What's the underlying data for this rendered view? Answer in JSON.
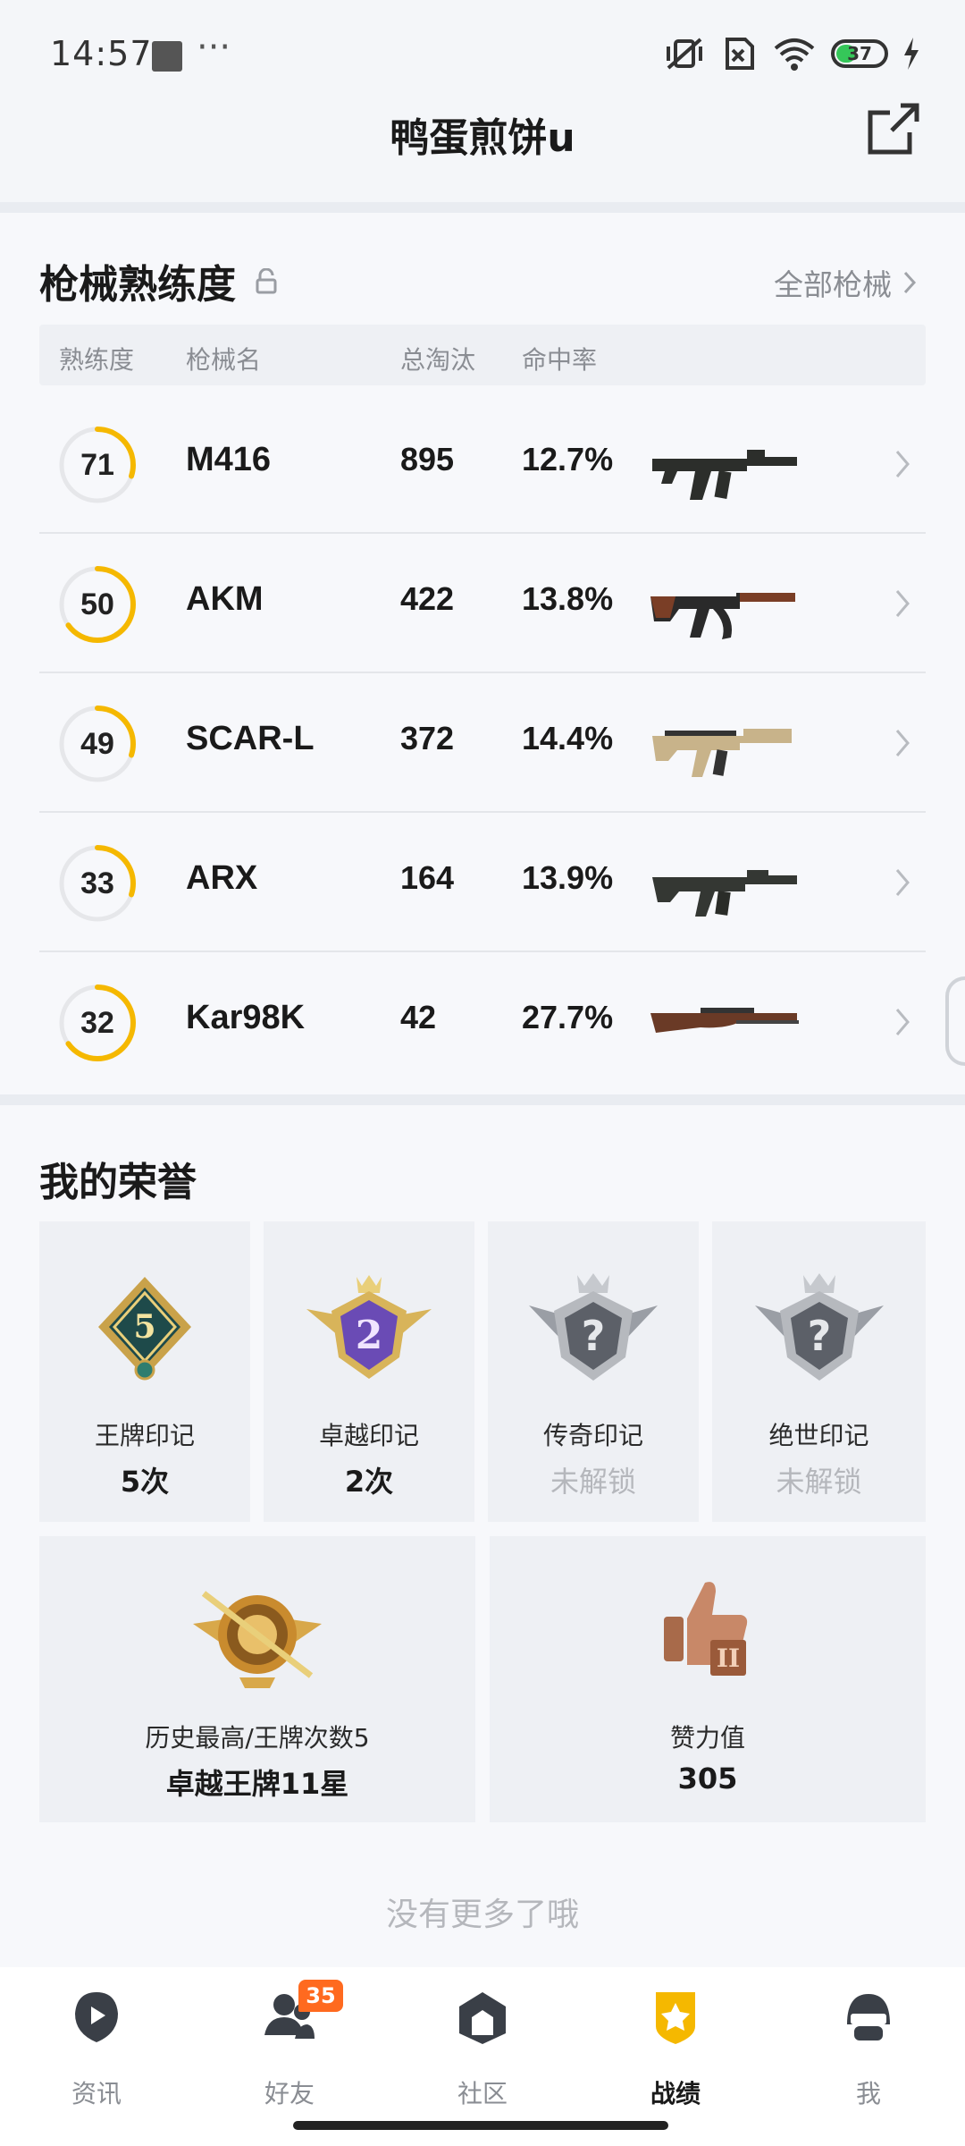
{
  "status_bar": {
    "time": "14:57",
    "dots": "···",
    "battery": "37"
  },
  "header": {
    "title": "鸭蛋煎饼u"
  },
  "weapons": {
    "title": "枪械熟练度",
    "all_link": "全部枪械",
    "columns": {
      "mastery": "熟练度",
      "name": "枪械名",
      "kills": "总淘汰",
      "accuracy": "命中率"
    },
    "rows": [
      {
        "mastery": "71",
        "mastery_fraction": 0.3,
        "name": "M416",
        "kills": "895",
        "accuracy": "12.7%",
        "gun_icon": "m416-rifle-icon"
      },
      {
        "mastery": "50",
        "mastery_fraction": 0.65,
        "name": "AKM",
        "kills": "422",
        "accuracy": "13.8%",
        "gun_icon": "akm-rifle-icon"
      },
      {
        "mastery": "49",
        "mastery_fraction": 0.3,
        "name": "SCAR-L",
        "kills": "372",
        "accuracy": "14.4%",
        "gun_icon": "scar-rifle-icon"
      },
      {
        "mastery": "33",
        "mastery_fraction": 0.3,
        "name": "ARX",
        "kills": "164",
        "accuracy": "13.9%",
        "gun_icon": "arx-rifle-icon"
      },
      {
        "mastery": "32",
        "mastery_fraction": 0.65,
        "name": "Kar98K",
        "kills": "42",
        "accuracy": "27.7%",
        "gun_icon": "kar98k-rifle-icon"
      }
    ]
  },
  "honors": {
    "title": "我的荣誉",
    "marks": [
      {
        "label": "王牌印记",
        "value": "5次",
        "locked": false,
        "badge_text": "5"
      },
      {
        "label": "卓越印记",
        "value": "2次",
        "locked": false,
        "badge_text": "2"
      },
      {
        "label": "传奇印记",
        "value": "未解锁",
        "locked": true,
        "badge_text": "?"
      },
      {
        "label": "绝世印记",
        "value": "未解锁",
        "locked": true,
        "badge_text": "?"
      }
    ],
    "history": {
      "label": "历史最高/王牌次数5",
      "value": "卓越王牌11星"
    },
    "likes": {
      "label": "赞力值",
      "value": "305"
    }
  },
  "footer_text": "没有更多了哦",
  "nav": {
    "items": [
      {
        "label": "资讯",
        "active": false
      },
      {
        "label": "好友",
        "active": false,
        "badge": "35"
      },
      {
        "label": "社区",
        "active": false
      },
      {
        "label": "战绩",
        "active": true
      },
      {
        "label": "我",
        "active": false
      }
    ]
  },
  "colors": {
    "accent": "#f5b800",
    "ring_track": "#e6e7ea",
    "badge": "#ff6a1f"
  }
}
